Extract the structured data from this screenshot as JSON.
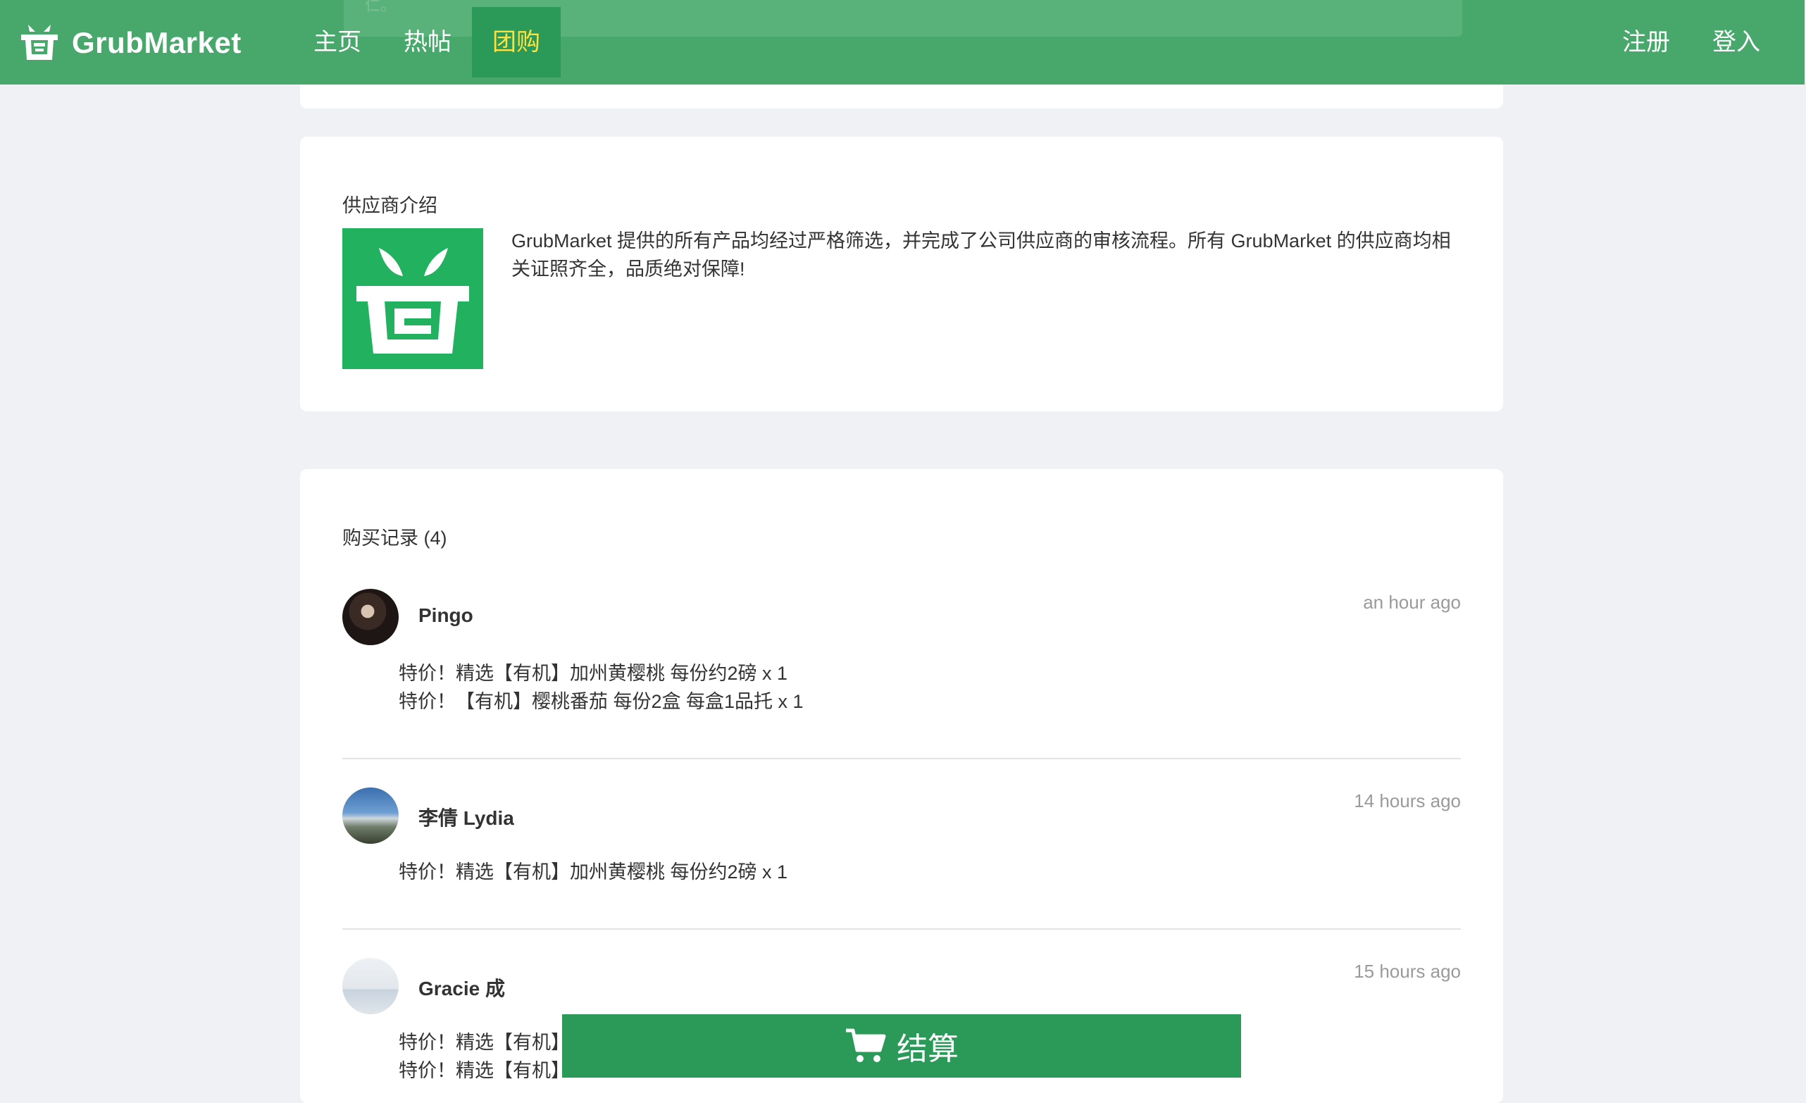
{
  "nav": {
    "brand": "GrubMarket",
    "peek_text": "仁。",
    "items": [
      {
        "label": "主页"
      },
      {
        "label": "热帖"
      },
      {
        "label": "团购"
      }
    ],
    "register": "注册",
    "login": "登入",
    "colors": {
      "bar": "#48a86c",
      "active_bg": "#2b9a58",
      "active_text": "#ffe03d"
    }
  },
  "supplier": {
    "title": "供应商介绍",
    "logo_icon": "grubmarket-basket-icon",
    "description": "GrubMarket 提供的所有产品均经过严格筛选，并完成了公司供应商的审核流程。所有 GrubMarket 的供应商均相关证照齐全，品质绝对保障!"
  },
  "records": {
    "title": "购买记录 (4)",
    "list": [
      {
        "name": "Pingo",
        "time": "an hour ago",
        "items": [
          "特价！精选【有机】加州黄樱桃 每份约2磅 x 1",
          "特价！【有机】樱桃番茄 每份2盒 每盒1品托 x 1"
        ]
      },
      {
        "name": "李倩 Lydia",
        "time": "14 hours ago",
        "items": [
          "特价！精选【有机】加州黄樱桃 每份约2磅 x 1"
        ]
      },
      {
        "name": "Gracie 成",
        "time": "15 hours ago",
        "items": [
          "特价！精选【有机】",
          "特价！精选【有机】"
        ]
      }
    ]
  },
  "checkout": {
    "label": "结算",
    "icon": "cart-icon",
    "color": "#2b9a58"
  }
}
